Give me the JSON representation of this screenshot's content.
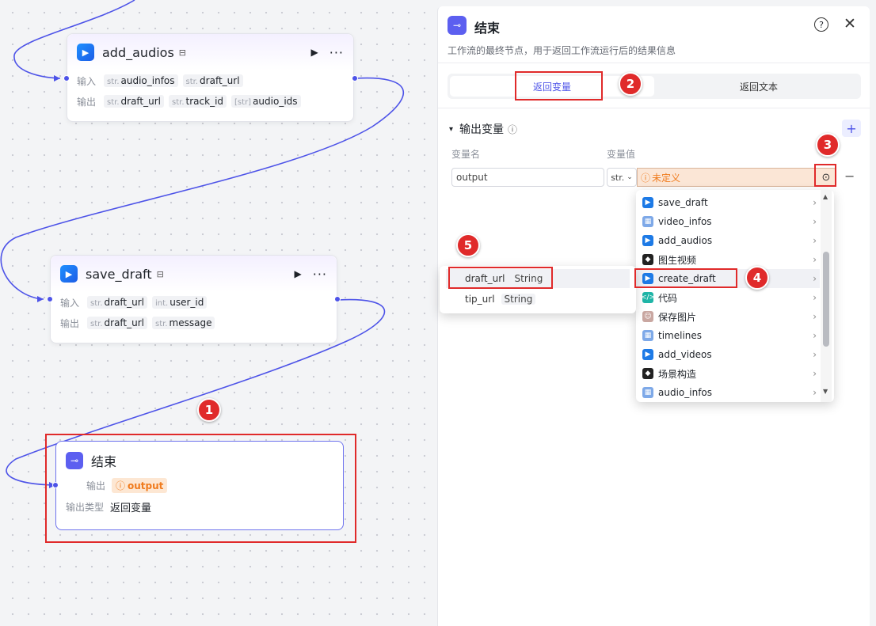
{
  "nodes": {
    "add_audios": {
      "title": "add_audios",
      "input_label": "输入",
      "output_label": "输出",
      "inputs": [
        {
          "type": "str.",
          "name": "audio_infos"
        },
        {
          "type": "str.",
          "name": "draft_url"
        }
      ],
      "outputs": [
        {
          "type": "str.",
          "name": "draft_url"
        },
        {
          "type": "str.",
          "name": "track_id"
        },
        {
          "type": "[str]",
          "name": "audio_ids"
        }
      ]
    },
    "save_draft": {
      "title": "save_draft",
      "input_label": "输入",
      "output_label": "输出",
      "inputs": [
        {
          "type": "str.",
          "name": "draft_url"
        },
        {
          "type": "int.",
          "name": "user_id"
        }
      ],
      "outputs": [
        {
          "type": "str.",
          "name": "draft_url"
        },
        {
          "type": "str.",
          "name": "message"
        }
      ]
    },
    "end": {
      "title": "结束",
      "output_label": "输出",
      "output_value": "output",
      "output_type_label": "输出类型",
      "output_type_value": "返回变量"
    }
  },
  "panel": {
    "title": "结束",
    "description": "工作流的最终节点，用于返回工作流运行后的结果信息",
    "tabs": [
      "返回变量",
      "返回文本"
    ],
    "active_tab": 0,
    "section_title": "输出变量",
    "col_name_label": "变量名",
    "col_value_label": "变量值",
    "var_name": "output",
    "var_type": "str.",
    "var_value_status": "未定义"
  },
  "dropdown": {
    "items": [
      {
        "label": "save_draft",
        "icon": "plugin-icon"
      },
      {
        "label": "video_infos",
        "icon": "code-plugin-icon"
      },
      {
        "label": "add_audios",
        "icon": "plugin-icon"
      },
      {
        "label": "图生视频",
        "icon": "dark-plugin-icon"
      },
      {
        "label": "create_draft",
        "icon": "plugin-icon"
      },
      {
        "label": "代码",
        "icon": "code-icon"
      },
      {
        "label": "保存图片",
        "icon": "image-plugin-icon"
      },
      {
        "label": "timelines",
        "icon": "code-plugin-icon"
      },
      {
        "label": "add_videos",
        "icon": "plugin-icon"
      },
      {
        "label": "场景构造",
        "icon": "dark-plugin-icon"
      },
      {
        "label": "audio_infos",
        "icon": "code-plugin-icon"
      }
    ],
    "hovered": 4
  },
  "submenu": {
    "items": [
      {
        "name": "draft_url",
        "type": "String"
      },
      {
        "name": "tip_url",
        "type": "String"
      }
    ]
  },
  "markers": [
    "1",
    "2",
    "3",
    "4",
    "5"
  ],
  "colors": {
    "accent": "#4d53e8",
    "annotation": "#e02a2a",
    "warning": "#f07b1d"
  }
}
